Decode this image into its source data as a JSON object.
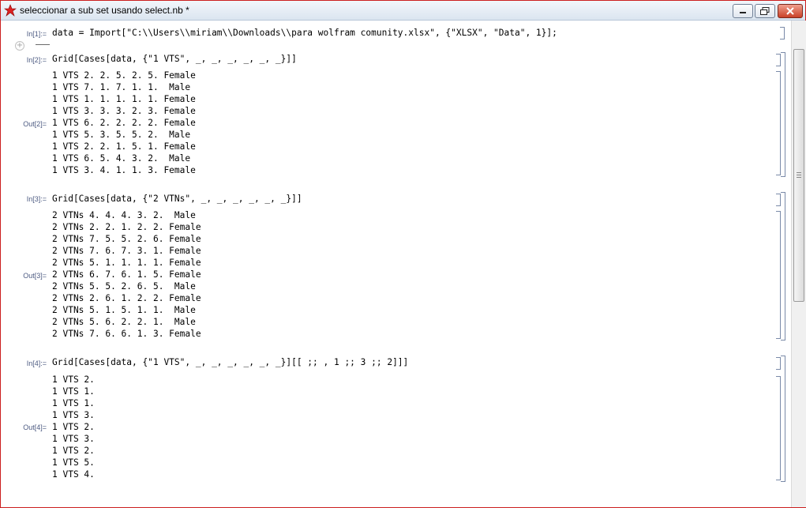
{
  "window": {
    "title": "seleccionar a sub set usando select.nb *"
  },
  "cells": [
    {
      "in_label": "In[1]:=",
      "input": "data = Import[\"C:\\\\Users\\\\miriam\\\\Downloads\\\\para wolfram comunity.xlsx\", {\"XLSX\", \"Data\", 1}];"
    },
    {
      "in_label": "In[2]:=",
      "input": "Grid[Cases[data, {\"1 VTS\", _, _, _, _, _, _}]]",
      "out_label": "Out[2]=",
      "rows": [
        "1 VTS 2. 2. 5. 2. 5. Female",
        "1 VTS 7. 1. 7. 1. 1.  Male",
        "1 VTS 1. 1. 1. 1. 1. Female",
        "1 VTS 3. 3. 3. 2. 3. Female",
        "1 VTS 6. 2. 2. 2. 2. Female",
        "1 VTS 5. 3. 5. 5. 2.  Male",
        "1 VTS 2. 2. 1. 5. 1. Female",
        "1 VTS 6. 5. 4. 3. 2.  Male",
        "1 VTS 3. 4. 1. 1. 3. Female"
      ]
    },
    {
      "in_label": "In[3]:=",
      "input": "Grid[Cases[data, {\"2 VTNs\", _, _, _, _, _, _}]]",
      "out_label": "Out[3]=",
      "rows": [
        "2 VTNs 4. 4. 4. 3. 2.  Male",
        "2 VTNs 2. 2. 1. 2. 2. Female",
        "2 VTNs 7. 5. 5. 2. 6. Female",
        "2 VTNs 7. 6. 7. 3. 1. Female",
        "2 VTNs 5. 1. 1. 1. 1. Female",
        "2 VTNs 6. 7. 6. 1. 5. Female",
        "2 VTNs 5. 5. 2. 6. 5.  Male",
        "2 VTNs 2. 6. 1. 2. 2. Female",
        "2 VTNs 5. 1. 5. 1. 1.  Male",
        "2 VTNs 5. 6. 2. 2. 1.  Male",
        "2 VTNs 7. 6. 6. 1. 3. Female"
      ]
    },
    {
      "in_label": "In[4]:=",
      "input": "Grid[Cases[data, {\"1 VTS\", _, _, _, _, _, _}][[ ;; , 1 ;; 3 ;; 2]]]",
      "out_label": "Out[4]=",
      "rows": [
        "1 VTS 2.",
        "1 VTS 1.",
        "1 VTS 1.",
        "1 VTS 3.",
        "1 VTS 2.",
        "1 VTS 3.",
        "1 VTS 2.",
        "1 VTS 5.",
        "1 VTS 4."
      ]
    }
  ],
  "colors": {
    "frame_border": "#cc1f1f",
    "label_blue": "#4d5b82",
    "bracket": "#7a8aa8"
  },
  "icons": {
    "app": "mathematica-spikey-icon",
    "minimize": "minimize-icon",
    "maximize": "restore-icon",
    "close": "close-icon"
  }
}
